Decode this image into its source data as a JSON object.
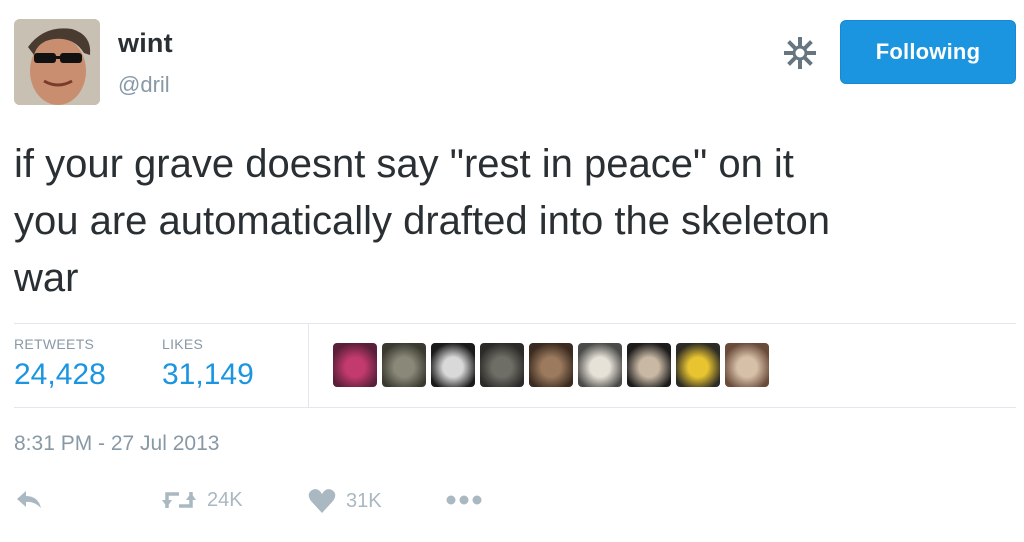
{
  "user": {
    "name": "wint",
    "handle": "@dril"
  },
  "follow_button": {
    "label": "Following",
    "color": "#1b95e0"
  },
  "icons": {
    "gear": "gear-icon",
    "reply": "reply-icon",
    "retweet": "retweet-icon",
    "like": "heart-icon",
    "more": "more-icon"
  },
  "tweet": {
    "lines": [
      "if your grave doesnt say \"rest in peace\" on it",
      "you are automatically drafted into the skeleton",
      "war"
    ]
  },
  "stats": {
    "retweets_label": "RETWEETS",
    "retweets_value": "24,428",
    "likes_label": "LIKES",
    "likes_value": "31,149"
  },
  "likers": [
    {
      "name": "liker-1",
      "colors": [
        "#5a1f3a",
        "#c23a6e"
      ]
    },
    {
      "name": "liker-2",
      "colors": [
        "#3a3a30",
        "#8a8878"
      ]
    },
    {
      "name": "liker-3",
      "colors": [
        "#1a1a1a",
        "#d9d9d9"
      ]
    },
    {
      "name": "liker-4",
      "colors": [
        "#2b2a28",
        "#6e6e66"
      ]
    },
    {
      "name": "liker-5",
      "colors": [
        "#3b2a1f",
        "#9b7a5e"
      ]
    },
    {
      "name": "liker-6",
      "colors": [
        "#4a4a48",
        "#e7e2d8"
      ]
    },
    {
      "name": "liker-7",
      "colors": [
        "#1c1c1c",
        "#c9b8a4"
      ]
    },
    {
      "name": "liker-8",
      "colors": [
        "#2c2b25",
        "#e8c431"
      ]
    },
    {
      "name": "liker-9",
      "colors": [
        "#6a4b3a",
        "#d7c0a8"
      ]
    }
  ],
  "timestamp": "8:31 PM - 27 Jul 2013",
  "actions": {
    "retweet_count": "24K",
    "like_count": "31K"
  }
}
